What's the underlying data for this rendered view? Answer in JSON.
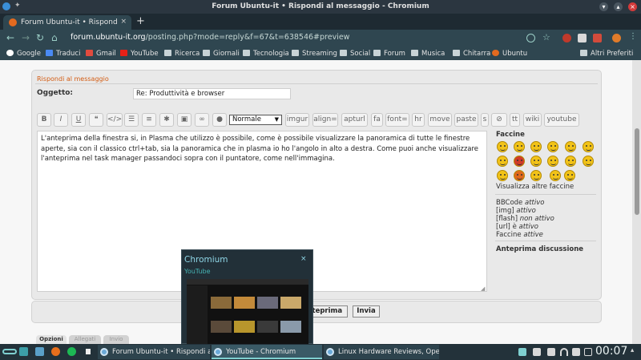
{
  "window": {
    "title": "Forum Ubuntu-it • Rispondi al messaggio - Chromium"
  },
  "browser": {
    "tab_label": "Forum Ubuntu-it • Rispondi al",
    "new_tab_glyph": "+",
    "url_domain": "forum.ubuntu-it.org",
    "url_path": "/posting.php?mode=reply&f=67&t=638546#preview"
  },
  "bookmarks": {
    "items": [
      "Google",
      "Traduci",
      "Gmail",
      "YouTube",
      "Ricerca",
      "Giornali",
      "Tecnologia",
      "Streaming",
      "Social",
      "Forum",
      "Musica",
      "Chitarra",
      "Ubuntu"
    ],
    "others": "Altri Preferiti"
  },
  "form": {
    "panel_title": "Rispondi al messaggio",
    "subject_label": "Oggetto:",
    "subject_value": "Re: Produttività e browser",
    "font_size_select": "Normale",
    "format_text_buttons": [
      "imgur",
      "align=",
      "apturl",
      "fa",
      "font=",
      "hr",
      "move",
      "paste",
      "s",
      "tt",
      "wiki",
      "youtube"
    ],
    "message": "L'anteprima della finestra si, in Plasma che utilizzo è possibile, come è possibile visualizzare la panoramica di tutte le finestre aperte, sia con il classico ctrl+tab, sia la panoramica che in  plasma io ho l'angolo in alto a destra.  Come puoi anche visualizzare l'anteprima nel task manager passandoci sopra con il puntatore, come nell'immagina.",
    "preview_button": "Anteprima",
    "submit_button": "Invia",
    "bottom_tabs": [
      "Opzioni",
      "Allegati",
      "Invio"
    ]
  },
  "sidebar": {
    "smilies_title": "Faccine",
    "more_smilies": "Visualizza altre faccine",
    "bbcode": "BBCode",
    "bbcode_state": "attivo",
    "img": "[img]",
    "img_state": "attivo",
    "flash": "[flash]",
    "flash_state": "non attivo",
    "url": "[url] è",
    "url_state": "attivo",
    "smilies": "Faccine",
    "smilies_state": "attive",
    "topic_preview": "Anteprima discussione"
  },
  "popup": {
    "title": "Chromium",
    "subtitle": "YouTube",
    "close_glyph": "×"
  },
  "taskbar": {
    "tasks": [
      "Forum Ubuntu-it • Rispondi al m...",
      "YouTube - Chromium",
      "Linux Hardware Reviews, Open-S..."
    ],
    "clock": "00:07"
  },
  "colors": {
    "panel_title": "#d35c13",
    "titlebar": "#2b3640",
    "toolbar": "#2f4650",
    "taskbar": "#23323a",
    "accent": "#7fd0d0"
  }
}
